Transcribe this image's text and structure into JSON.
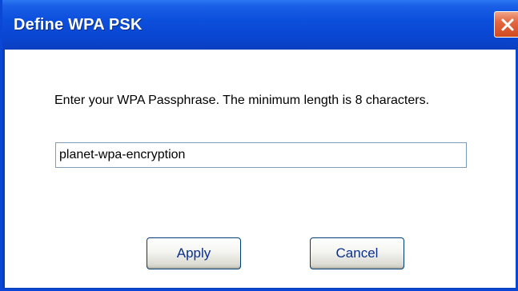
{
  "window": {
    "title": "Define WPA PSK"
  },
  "dialog": {
    "prompt": "Enter your WPA Passphrase.  The minimum length is 8 characters.",
    "passphrase_value": "planet-wpa-encryption"
  },
  "buttons": {
    "apply_label": "Apply",
    "cancel_label": "Cancel"
  },
  "icons": {
    "close": "close-icon"
  },
  "colors": {
    "titlebar": "#0a46d2",
    "close_button": "#d14a20",
    "button_text": "#0a2f8c"
  }
}
